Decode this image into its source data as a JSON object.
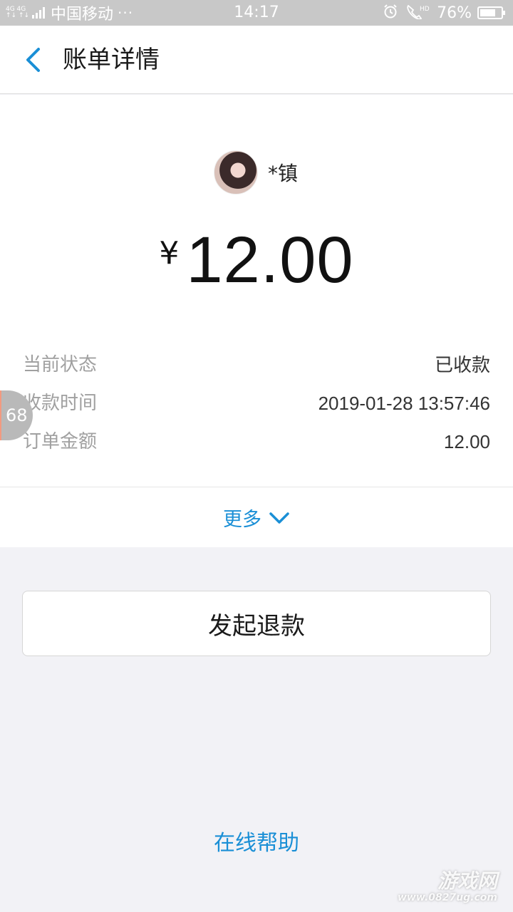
{
  "status_bar": {
    "network_top": "4G 4G",
    "network_bottom": "↑↓ ↑↓",
    "carrier": "中国移动",
    "more": "···",
    "time": "14:17",
    "alarm_icon": "alarm-icon",
    "call_hd_icon": "hd-call-icon",
    "battery": "76%",
    "battery_level": 0.76
  },
  "header": {
    "title": "账单详情",
    "back_icon": "chevron-left-icon"
  },
  "payer": {
    "name": "*镇"
  },
  "amount": {
    "currency": "¥",
    "value": "12.00"
  },
  "details": [
    {
      "label": "当前状态",
      "value": "已收款"
    },
    {
      "label": "收款时间",
      "value": "2019-01-28 13:57:46"
    },
    {
      "label": "订单金额",
      "value": "12.00"
    }
  ],
  "more": {
    "label": "更多"
  },
  "float_badge": "68",
  "refund_button": "发起退款",
  "help_link": "在线帮助",
  "watermark": {
    "main": "游戏网",
    "url": "www.0827ug.com"
  },
  "colors": {
    "accent": "#1a8fd6",
    "status_bar": "#c8c8c8",
    "page_bg": "#f2f2f6"
  }
}
